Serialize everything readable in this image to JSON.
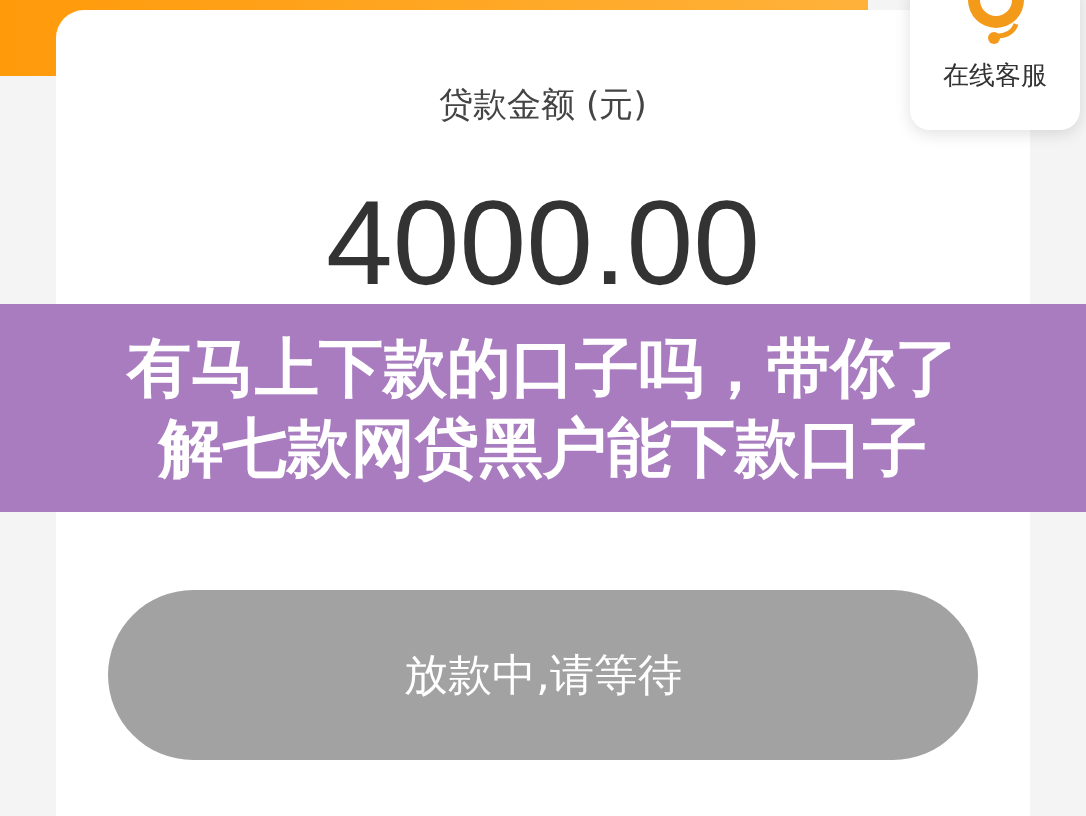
{
  "service": {
    "label": "在线客服"
  },
  "loan": {
    "label": "贷款金额 (元)",
    "amount": "4000.00"
  },
  "banner": {
    "title": "有马上下款的口子吗，带你了解七款网贷黑户能下款口子"
  },
  "button": {
    "label": "放款中,请等待",
    "disabled": true
  }
}
